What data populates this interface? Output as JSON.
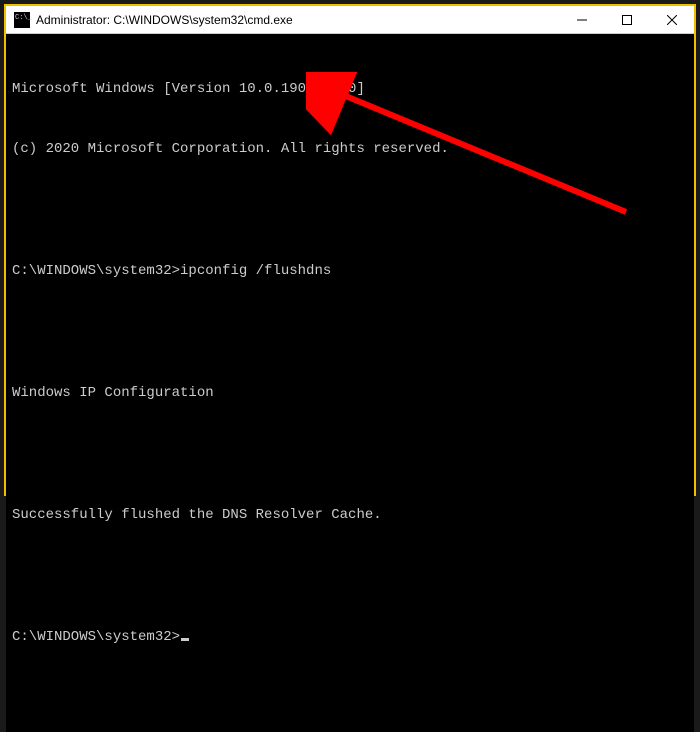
{
  "window": {
    "title": "Administrator: C:\\WINDOWS\\system32\\cmd.exe"
  },
  "terminal": {
    "line1": "Microsoft Windows [Version 10.0.19042.870]",
    "line2": "(c) 2020 Microsoft Corporation. All rights reserved.",
    "blank1": " ",
    "prompt1_prefix": "C:\\WINDOWS\\system32>",
    "prompt1_cmd": "ipconfig /flushdns",
    "blank2": " ",
    "line3": "Windows IP Configuration",
    "blank3": " ",
    "line4": "Successfully flushed the DNS Resolver Cache.",
    "blank4": " ",
    "prompt2_prefix": "C:\\WINDOWS\\system32>"
  },
  "watermark": "    "
}
